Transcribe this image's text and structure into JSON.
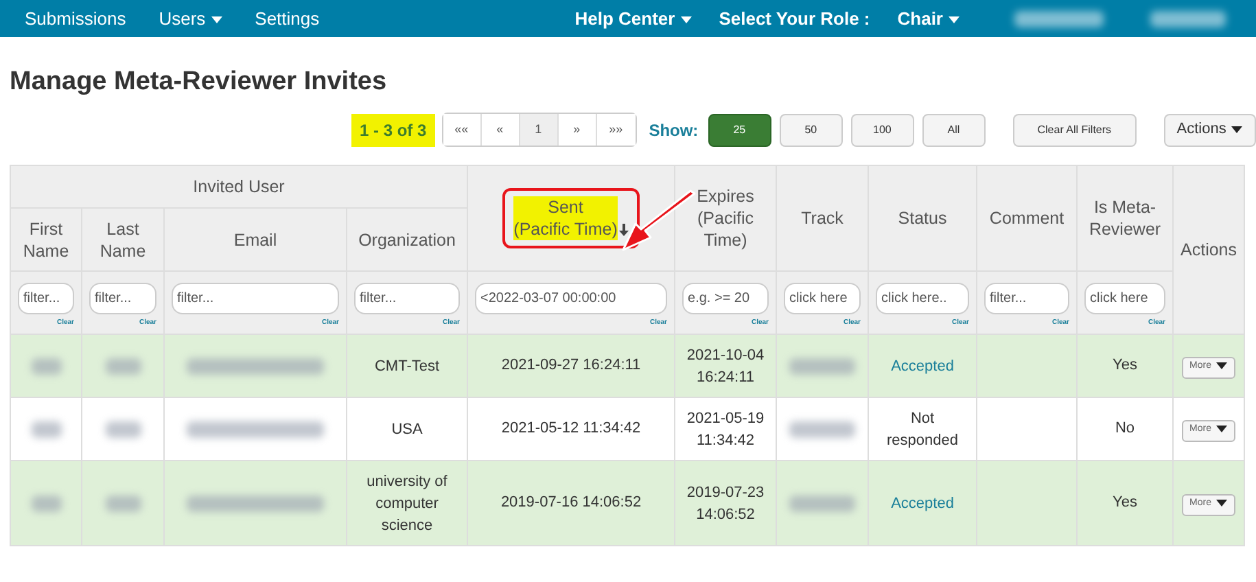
{
  "navbar": {
    "items": [
      {
        "label": "Submissions",
        "dropdown": false
      },
      {
        "label": "Users",
        "dropdown": true
      },
      {
        "label": "Settings",
        "dropdown": false
      }
    ],
    "right": [
      {
        "label": "Help Center",
        "dropdown": true
      },
      {
        "label": "Select Your Role :",
        "dropdown": false
      },
      {
        "label": "Chair",
        "dropdown": true
      }
    ]
  },
  "title": "Manage Meta-Reviewer Invites",
  "toolbar": {
    "count": "1 - 3 of 3",
    "count_highlighted": true,
    "pager": [
      {
        "label": "««",
        "selected": false
      },
      {
        "label": "«",
        "selected": false
      },
      {
        "label": "1",
        "selected": true
      },
      {
        "label": "»",
        "selected": false
      },
      {
        "label": "»»",
        "selected": false
      }
    ],
    "show_label": "Show:",
    "sizes": [
      {
        "label": "25",
        "selected": true
      },
      {
        "label": "50",
        "selected": false
      },
      {
        "label": "100",
        "selected": false
      },
      {
        "label": "All",
        "selected": false
      }
    ],
    "clear_filters": "Clear All Filters",
    "actions": "Actions"
  },
  "table": {
    "group": "Invited User",
    "columns": [
      {
        "label": "First Name",
        "sort": false,
        "highlighted": false
      },
      {
        "label": "Last Name",
        "sort": false,
        "highlighted": false
      },
      {
        "label": "Email",
        "sort": false,
        "highlighted": false
      },
      {
        "label": "Organization",
        "sort": false,
        "highlighted": false
      },
      {
        "label": "Sent\n(Pacific Time)",
        "sort": true,
        "highlighted": true
      },
      {
        "label": "Expires (Pacific Time)",
        "sort": false,
        "highlighted": false
      },
      {
        "label": "Track",
        "sort": false,
        "highlighted": false
      },
      {
        "label": "Status",
        "sort": false,
        "highlighted": false
      },
      {
        "label": "Comment",
        "sort": false,
        "highlighted": false
      },
      {
        "label": "Is Meta-Reviewer",
        "sort": false,
        "highlighted": false
      },
      {
        "label": "Actions",
        "sort": false,
        "highlighted": false
      }
    ],
    "filters": [
      {
        "placeholder": "filter...",
        "clear": "Clear"
      },
      {
        "placeholder": "filter...",
        "clear": "Clear"
      },
      {
        "placeholder": "filter...",
        "clear": "Clear"
      },
      {
        "placeholder": "filter...",
        "clear": "Clear"
      },
      {
        "value": "<2022-03-07 00:00:00",
        "clear": "Clear"
      },
      {
        "placeholder": "e.g. >= 20",
        "clear": "Clear"
      },
      {
        "placeholder": "click here",
        "clear": "Clear"
      },
      {
        "placeholder": "click here..",
        "clear": "Clear"
      },
      {
        "placeholder": "filter...",
        "clear": "Clear"
      },
      {
        "placeholder": "click here",
        "clear": "Clear"
      }
    ],
    "rows": [
      {
        "highlighted": true,
        "organization": "CMT-Test",
        "sent": "2021-09-27 16:24:11",
        "expires": "2021-10-04\n16:24:11",
        "status": {
          "label": "Accepted",
          "color": "#1a7f9a"
        },
        "meta": "Yes",
        "action": "More"
      },
      {
        "highlighted": false,
        "organization": "USA",
        "sent": "2021-05-12 11:34:42",
        "expires": "2021-05-19\n11:34:42",
        "status": {
          "label": "Not responded",
          "color": "#333333"
        },
        "meta": "No",
        "action": "More"
      },
      {
        "highlighted": true,
        "organization": "university of computer science",
        "sent": "2019-07-16 14:06:52",
        "expires": "2019-07-23\n14:06:52",
        "status": {
          "label": "Accepted",
          "color": "#1a7f9a"
        },
        "meta": "Yes",
        "action": "More"
      }
    ]
  }
}
